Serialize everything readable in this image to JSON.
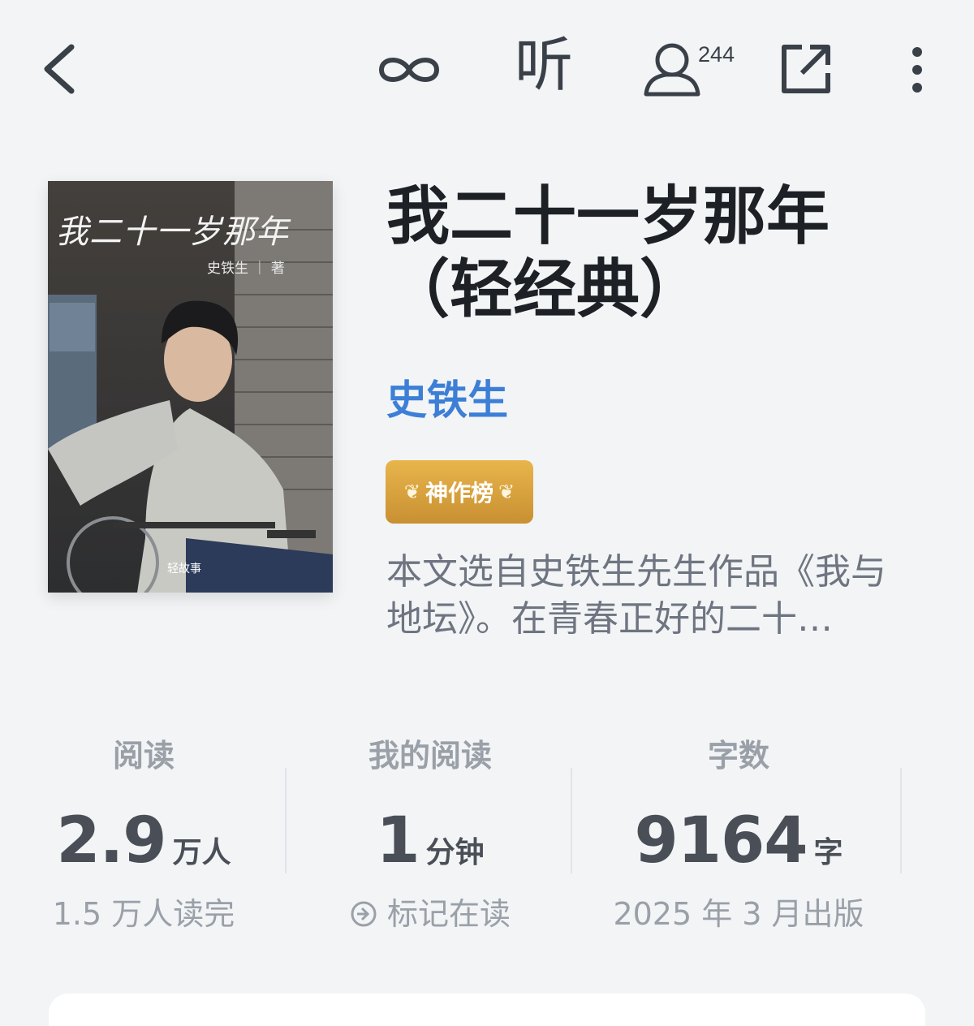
{
  "toolbar": {
    "listen_label": "听",
    "people_count": "244"
  },
  "book": {
    "title": "我二十一岁那年（轻经典）",
    "author": "史铁生",
    "badge": "神作榜",
    "description": "本文选自史铁生先生作品《我与地坛》。在青春正好的二十…",
    "cover": {
      "title": "我二十一岁那年",
      "author_line": "史铁生 ｜ 著",
      "brand": "轻故事"
    }
  },
  "stats": {
    "reads": {
      "label": "阅读",
      "value": "2.9",
      "unit": "万人",
      "sub": "1.5 万人读完"
    },
    "my_reading": {
      "label": "我的阅读",
      "value": "1",
      "unit": "分钟",
      "sub": "标记在读"
    },
    "word_count": {
      "label": "字数",
      "value": "9164",
      "unit": "字",
      "sub": "2025 年 3 月出版"
    }
  },
  "colors": {
    "background": "#f2f4f6",
    "author_link": "#3d7fd6",
    "badge_gold": "#d6a03e"
  }
}
